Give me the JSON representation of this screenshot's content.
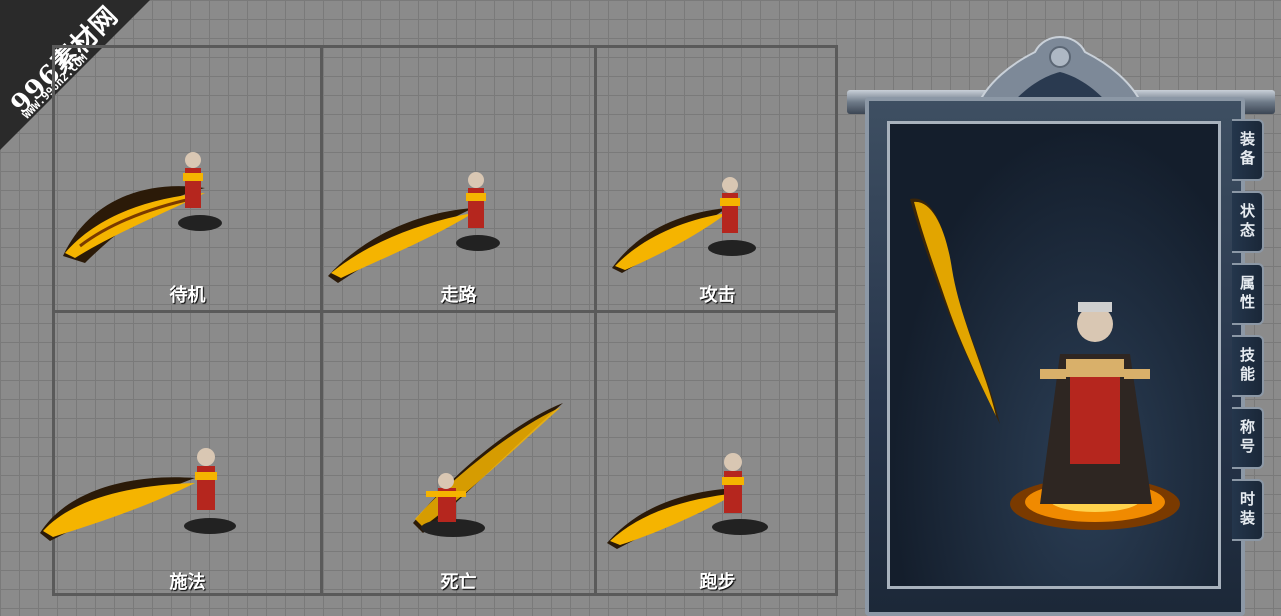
{
  "watermark": {
    "title": "996素材网",
    "url": "WWW.996n2.COM"
  },
  "cells": [
    {
      "label": "待机"
    },
    {
      "label": "走路"
    },
    {
      "label": "攻击"
    },
    {
      "label": "施法"
    },
    {
      "label": "死亡"
    },
    {
      "label": "跑步"
    }
  ],
  "panel": {
    "tabs": [
      {
        "label": "装备"
      },
      {
        "label": "状态"
      },
      {
        "label": "属性"
      },
      {
        "label": "技能"
      },
      {
        "label": "称号"
      },
      {
        "label": "时装"
      }
    ]
  },
  "colors": {
    "flame": "#f5b400",
    "flame_dark": "#7a3a00",
    "armor_red": "#b5261e",
    "grid_line": "#5a5a5a",
    "panel_bg": "#1c2838"
  }
}
